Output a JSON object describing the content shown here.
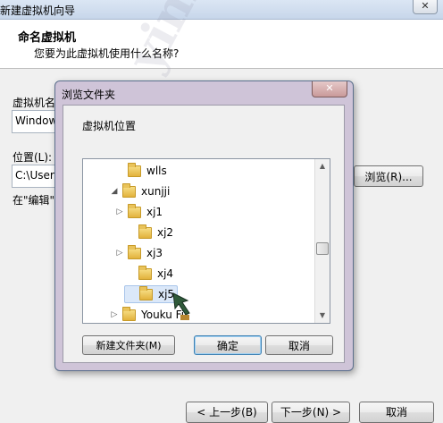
{
  "window": {
    "title": "新建虚拟机向导",
    "close_glyph": "✕"
  },
  "header": {
    "title": "命名虚拟机",
    "subtitle": "您要为此虚拟机使用什么名称?"
  },
  "form": {
    "vm_name_label": "虚拟机名",
    "vm_name_value": "Window",
    "location_label": "位置(L):",
    "location_value": "C:\\Users",
    "browse_button": "浏览(R)...",
    "hint_text": "在\"编辑\""
  },
  "dialog": {
    "title": "浏览文件夹",
    "close_glyph": "✕",
    "prompt": "虚拟机位置",
    "tree": [
      {
        "label": "wlls",
        "expander": "",
        "selected": false
      },
      {
        "label": "xunjji",
        "expander": "◢",
        "selected": false
      },
      {
        "label": "xj1",
        "expander": "▷",
        "selected": false
      },
      {
        "label": "xj2",
        "expander": "",
        "selected": false
      },
      {
        "label": "xj3",
        "expander": "▷",
        "selected": false
      },
      {
        "label": "xj4",
        "expander": "",
        "selected": false
      },
      {
        "label": "xj5",
        "expander": "",
        "selected": true
      },
      {
        "label": "Youku Fil",
        "expander": "▷",
        "selected": false
      }
    ],
    "new_folder_button": "新建文件夹(M)",
    "ok_button": "确定",
    "cancel_button": "取消",
    "scroll_up": "▲",
    "scroll_down": "▼"
  },
  "footer": {
    "back_button": "< 上一步(B)",
    "next_button": "下一步(N) >",
    "cancel_button": "取消"
  },
  "watermark_text": "yiniujiang.com"
}
